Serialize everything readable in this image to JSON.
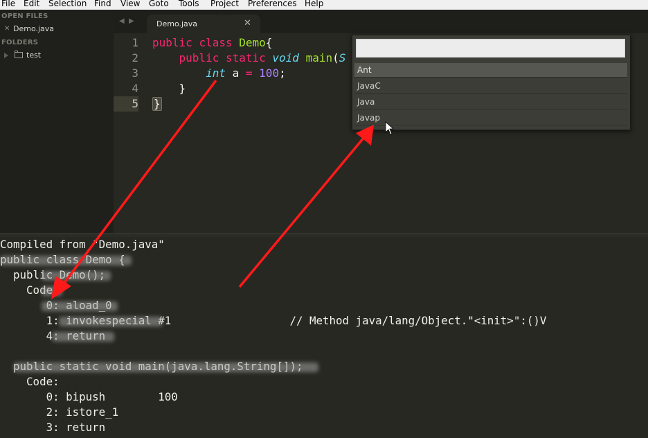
{
  "menu": [
    "File",
    "Edit",
    "Selection",
    "Find",
    "View",
    "Goto",
    "Tools",
    "Project",
    "Preferences",
    "Help"
  ],
  "sidebar": {
    "open_files_header": "OPEN FILES",
    "open_file": "Demo.java",
    "close_glyph": "✕",
    "folders_header": "FOLDERS",
    "folder": "test"
  },
  "tabs": {
    "nav_left": "◀",
    "nav_right": "▶",
    "active": "Demo.java",
    "close_glyph": "✕"
  },
  "editor": {
    "line_numbers": [
      "1",
      "2",
      "3",
      "4",
      "5"
    ],
    "current_line": 5,
    "line1": {
      "kw1": "public",
      "kw2": "class",
      "name": "Demo",
      "brace": "{"
    },
    "line2": {
      "kw1": "public",
      "kw2": "static",
      "type": "void",
      "fn": "main",
      "paren": "(",
      "tail": "S"
    },
    "line3": {
      "type": "int",
      "var": "a",
      "op": "=",
      "value": "100",
      "semi": ";"
    },
    "line4": {
      "brace": "}"
    },
    "line5": {
      "brace": "}"
    }
  },
  "build_popup": {
    "input_value": "",
    "items": [
      "Ant",
      "JavaC",
      "Java",
      "Javap"
    ],
    "selected": "Ant",
    "hovered": "Javap"
  },
  "output": {
    "lines": [
      "Compiled from \"Demo.java\"",
      "public class Demo {",
      "  public Demo();",
      "    Code:",
      "       0: aload_0",
      "       1: invokespecial #1                  // Method java/lang/Object.\"<init>\":()V",
      "       4: return",
      "",
      "  public static void main(java.lang.String[]);",
      "    Code:",
      "       0: bipush        100",
      "       2: istore_1",
      "       3: return"
    ]
  },
  "colors": {
    "background": "#272822",
    "keyword": "#f92672",
    "class_name": "#a6e22e",
    "type": "#66d9ef",
    "number": "#ae81ff",
    "arrow": "#ff1a1a"
  }
}
